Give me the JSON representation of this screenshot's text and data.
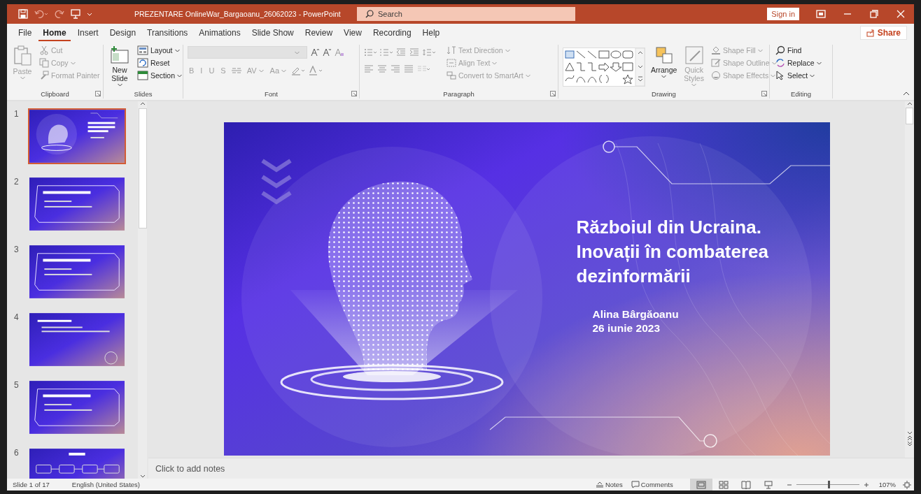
{
  "window": {
    "title": "PREZENTARE OnlineWar_Bargaoanu_26062023  -  PowerPoint",
    "search_placeholder": "Search",
    "sign_in": "Sign in"
  },
  "tabs": [
    {
      "label": "File",
      "selected": false
    },
    {
      "label": "Home",
      "selected": true
    },
    {
      "label": "Insert",
      "selected": false
    },
    {
      "label": "Design",
      "selected": false
    },
    {
      "label": "Transitions",
      "selected": false
    },
    {
      "label": "Animations",
      "selected": false
    },
    {
      "label": "Slide Show",
      "selected": false
    },
    {
      "label": "Review",
      "selected": false
    },
    {
      "label": "View",
      "selected": false
    },
    {
      "label": "Recording",
      "selected": false
    },
    {
      "label": "Help",
      "selected": false
    }
  ],
  "share": "Share",
  "ribbon": [
    {
      "kind": "clipboard",
      "label": "Clipboard",
      "launcher": true,
      "commands": [
        {
          "label": "Paste",
          "disabled": true
        },
        {
          "label": "Cut",
          "disabled": true
        },
        {
          "label": "Copy",
          "disabled": true
        },
        {
          "label": "Format Painter",
          "disabled": true
        }
      ]
    },
    {
      "kind": "slides",
      "label": "Slides",
      "launcher": false,
      "commands": [
        {
          "label": "New Slide",
          "disabled": false
        },
        {
          "label": "Layout",
          "disabled": false
        },
        {
          "label": "Reset",
          "disabled": false
        },
        {
          "label": "Section",
          "disabled": false
        }
      ]
    },
    {
      "kind": "font",
      "label": "Font",
      "launcher": true,
      "commands": [
        {
          "label": "B",
          "disabled": true
        },
        {
          "label": "I",
          "disabled": true
        },
        {
          "label": "U",
          "disabled": true
        },
        {
          "label": "S",
          "disabled": true
        },
        {
          "label": "AV",
          "disabled": true
        },
        {
          "label": "Aa",
          "disabled": true
        }
      ]
    },
    {
      "kind": "paragraph",
      "label": "Paragraph",
      "launcher": true,
      "commands": [
        {
          "label": "Text Direction",
          "disabled": true
        },
        {
          "label": "Align Text",
          "disabled": true
        },
        {
          "label": "Convert to SmartArt",
          "disabled": true
        }
      ]
    },
    {
      "kind": "drawing",
      "label": "Drawing",
      "launcher": true,
      "commands": [
        {
          "label": "Arrange",
          "disabled": false
        },
        {
          "label": "Quick Styles",
          "disabled": true
        },
        {
          "label": "Shape Fill",
          "disabled": true
        },
        {
          "label": "Shape Outline",
          "disabled": true
        },
        {
          "label": "Shape Effects",
          "disabled": true
        }
      ]
    },
    {
      "kind": "editing",
      "label": "Editing",
      "launcher": false,
      "commands": [
        {
          "label": "Find",
          "disabled": false
        },
        {
          "label": "Replace",
          "disabled": false
        },
        {
          "label": "Select",
          "disabled": false
        }
      ]
    }
  ],
  "thumbnails": [
    {
      "number": "1",
      "kind": "title",
      "selected": true
    },
    {
      "number": "2",
      "kind": "box",
      "selected": false
    },
    {
      "number": "3",
      "kind": "box",
      "selected": false
    },
    {
      "number": "4",
      "kind": "plain",
      "selected": false
    },
    {
      "number": "5",
      "kind": "box",
      "selected": false
    },
    {
      "number": "6",
      "kind": "flow",
      "selected": false
    }
  ],
  "slide": {
    "title_lines": [
      "Războiul din Ucraina.",
      "Inovații în combaterea",
      "dezinformării"
    ],
    "author": "Alina Bârgăoanu",
    "date": "26 iunie 2023"
  },
  "notes": {
    "placeholder": "Click to add notes"
  },
  "status_bar": {
    "slide_info": "Slide 1 of 17",
    "language": "English (United States)",
    "notes_button": "Notes",
    "comments_button": "Comments",
    "views": [
      {
        "kind": "normal",
        "selected": true
      },
      {
        "kind": "sorter",
        "selected": false
      },
      {
        "kind": "reading",
        "selected": false
      },
      {
        "kind": "slideshow",
        "selected": false
      }
    ],
    "zoom": {
      "level": 0.51,
      "reading": "107%"
    }
  }
}
